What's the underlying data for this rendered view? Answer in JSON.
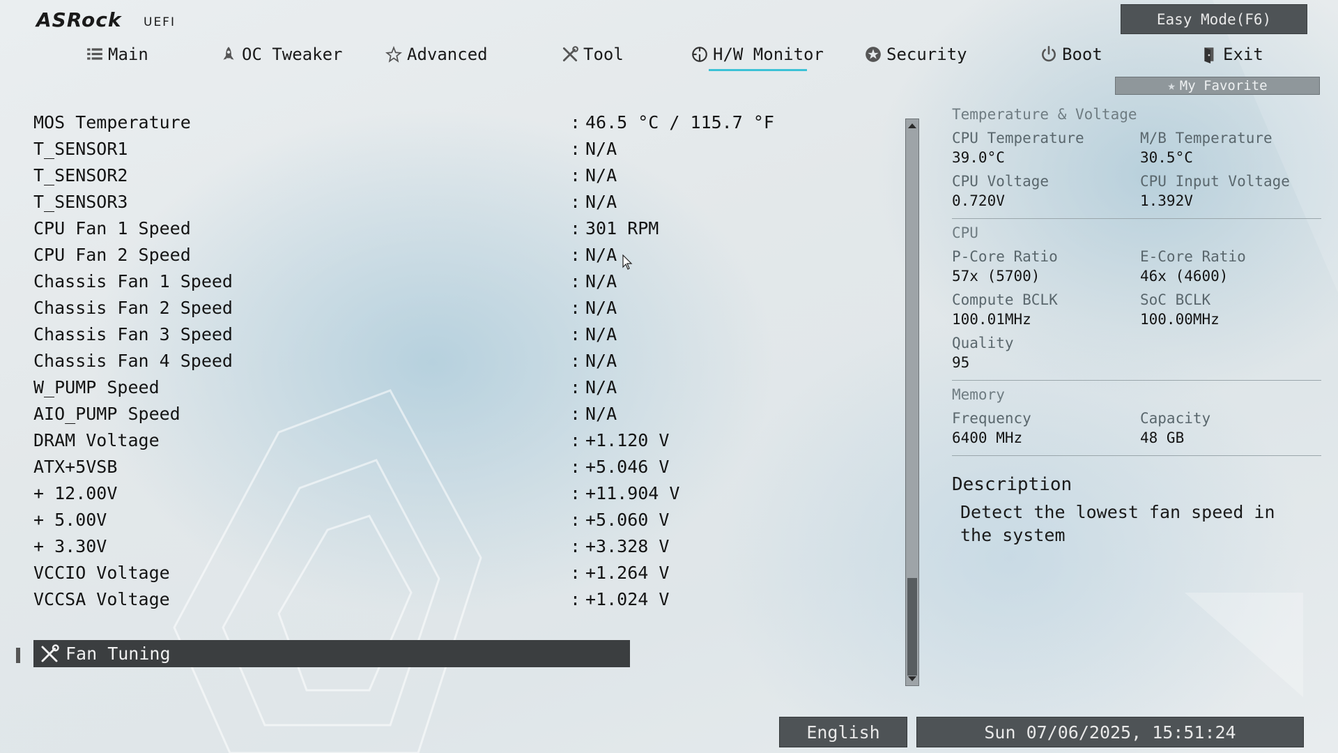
{
  "header": {
    "brand": "ASRock",
    "subtitle": "UEFI",
    "easy_mode_label": "Easy Mode(F6)",
    "my_favorite_label": "My Favorite"
  },
  "nav": [
    {
      "label": "Main",
      "icon": "list-icon"
    },
    {
      "label": "OC Tweaker",
      "icon": "rocket-icon"
    },
    {
      "label": "Advanced",
      "icon": "star-icon"
    },
    {
      "label": "Tool",
      "icon": "tools-icon"
    },
    {
      "label": "H/W Monitor",
      "icon": "gauge-icon",
      "active": true
    },
    {
      "label": "Security",
      "icon": "shield-icon"
    },
    {
      "label": "Boot",
      "icon": "power-icon"
    },
    {
      "label": "Exit",
      "icon": "exit-door-icon"
    }
  ],
  "main": {
    "items": [
      {
        "label": "MOS Temperature",
        "value": "46.5 °C / 115.7 °F"
      },
      {
        "label": "T_SENSOR1",
        "value": "N/A"
      },
      {
        "label": "T_SENSOR2",
        "value": "N/A"
      },
      {
        "label": "T_SENSOR3",
        "value": "N/A"
      },
      {
        "label": "CPU Fan 1 Speed",
        "value": "301 RPM"
      },
      {
        "label": "CPU Fan 2 Speed",
        "value": "N/A"
      },
      {
        "label": "Chassis Fan 1 Speed",
        "value": "N/A"
      },
      {
        "label": "Chassis Fan 2 Speed",
        "value": "N/A"
      },
      {
        "label": "Chassis Fan 3 Speed",
        "value": "N/A"
      },
      {
        "label": "Chassis Fan 4 Speed",
        "value": "N/A"
      },
      {
        "label": "W_PUMP Speed",
        "value": "N/A"
      },
      {
        "label": "AIO_PUMP Speed",
        "value": "N/A"
      },
      {
        "label": "DRAM Voltage",
        "value": "+1.120 V"
      },
      {
        "label": "ATX+5VSB",
        "value": "+5.046 V"
      },
      {
        "label": "+ 12.00V",
        "value": "+11.904 V"
      },
      {
        "label": "+ 5.00V",
        "value": "+5.060 V"
      },
      {
        "label": "+ 3.30V",
        "value": "+3.328 V"
      },
      {
        "label": "VCCIO Voltage",
        "value": "+1.264 V"
      },
      {
        "label": "VCCSA Voltage",
        "value": "+1.024 V"
      }
    ],
    "separator": ":",
    "fan_tuning_label": "Fan Tuning"
  },
  "sidebar": {
    "temp_voltage": {
      "heading": "Temperature & Voltage",
      "cpu_temp_label": "CPU Temperature",
      "cpu_temp_value": "39.0°C",
      "mb_temp_label": "M/B Temperature",
      "mb_temp_value": "30.5°C",
      "cpu_voltage_label": "CPU Voltage",
      "cpu_voltage_value": "0.720V",
      "cpu_input_voltage_label": "CPU Input Voltage",
      "cpu_input_voltage_value": "1.392V"
    },
    "cpu": {
      "heading": "CPU",
      "pcore_label": "P-Core Ratio",
      "pcore_value": "57x (5700)",
      "ecore_label": "E-Core Ratio",
      "ecore_value": "46x (4600)",
      "compute_bclk_label": "Compute BCLK",
      "compute_bclk_value": "100.01MHz",
      "soc_bclk_label": "SoC BCLK",
      "soc_bclk_value": "100.00MHz",
      "quality_label": "Quality",
      "quality_value": "95"
    },
    "memory": {
      "heading": "Memory",
      "frequency_label": "Frequency",
      "frequency_value": "6400 MHz",
      "capacity_label": "Capacity",
      "capacity_value": "48 GB"
    },
    "description": {
      "title": "Description",
      "text": "Detect the lowest fan speed in the system"
    }
  },
  "footer": {
    "language": "English",
    "datetime": "Sun 07/06/2025, 15:51:24"
  }
}
